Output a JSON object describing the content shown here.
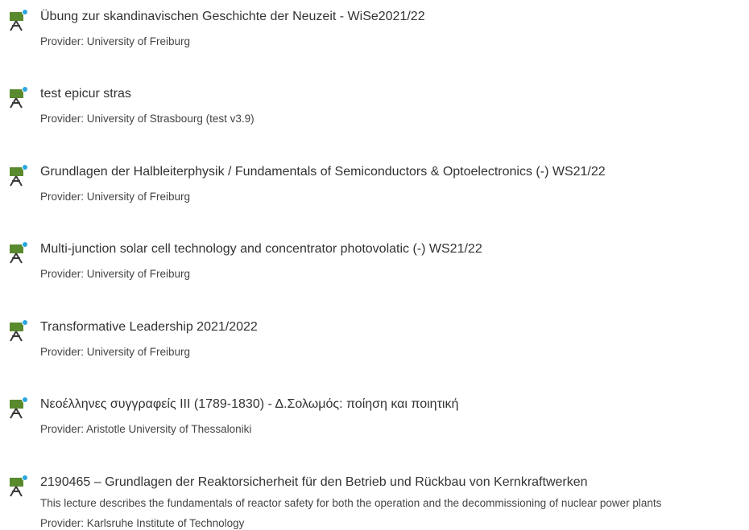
{
  "provider_prefix": "Provider: ",
  "courses": [
    {
      "title": "Übung zur skandinavischen Geschichte der Neuzeit - WiSe2021/22",
      "provider": "Provider: University of Freiburg"
    },
    {
      "title": "test epicur stras",
      "provider": "Provider: University of Strasbourg (test v3.9)"
    },
    {
      "title": "Grundlagen der Halbleiterphysik / Fundamentals of Semiconductors & Optoelectronics (-) WS21/22",
      "provider": "Provider: University of Freiburg"
    },
    {
      "title": "Multi-junction solar cell technology and concentrator photovolatic (-) WS21/22",
      "provider": "Provider: University of Freiburg"
    },
    {
      "title": "Transformative Leadership 2021/2022",
      "provider": "Provider: University of Freiburg"
    },
    {
      "title": "Νεοέλληνες συγγραφείς ΙΙΙ (1789-1830) - Δ.Σολωμός: ποίηση και ποιητική",
      "provider": "Provider: Aristotle University of Thessaloniki"
    },
    {
      "title": "2190465 – Grundlagen der Reaktorsicherheit für den Betrieb und Rückbau von Kernkraftwerken",
      "description": "This lecture describes the fundamentals of reactor safety for both the operation and the decommissioning of nuclear power plants",
      "provider": "Provider: Karlsruhe Institute of Technology"
    }
  ],
  "icon": {
    "name": "course-icon",
    "board_color": "#5a8a2e",
    "easel_color": "#3a3a3a",
    "badge_color": "#2aa7df"
  }
}
